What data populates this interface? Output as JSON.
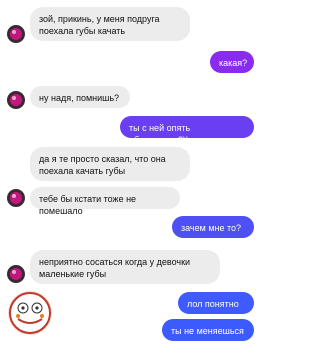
{
  "colors": {
    "incoming_bg": "#ececec",
    "outgoing_purple": "#8a2cf0",
    "outgoing_blue": "#3b5bff",
    "avatar_magenta": "#c2187e"
  },
  "messages": [
    {
      "side": "in",
      "text": "зой, прикинь, у меня подруга\nпоехала губы качать"
    },
    {
      "side": "out",
      "text": "какая?"
    },
    {
      "side": "in",
      "text": "ну надя, помнишь?"
    },
    {
      "side": "out",
      "text": "ты с ней опять общаешься?))"
    },
    {
      "side": "in",
      "text": "да я те просто сказал, что она\nпоехала качать губы"
    },
    {
      "side": "in",
      "text": "тебе бы кстати тоже не помешало"
    },
    {
      "side": "out",
      "text": "зачем мне то?"
    },
    {
      "side": "in",
      "text": "неприятно сосаться когда у девочки\nмаленькие губы"
    },
    {
      "side": "out",
      "text": "лол понятно"
    },
    {
      "side": "out",
      "text": "ты не меняешься"
    }
  ],
  "icons": {
    "contact_avatar": "avatar-icon",
    "sticker": "sticker-icon"
  }
}
